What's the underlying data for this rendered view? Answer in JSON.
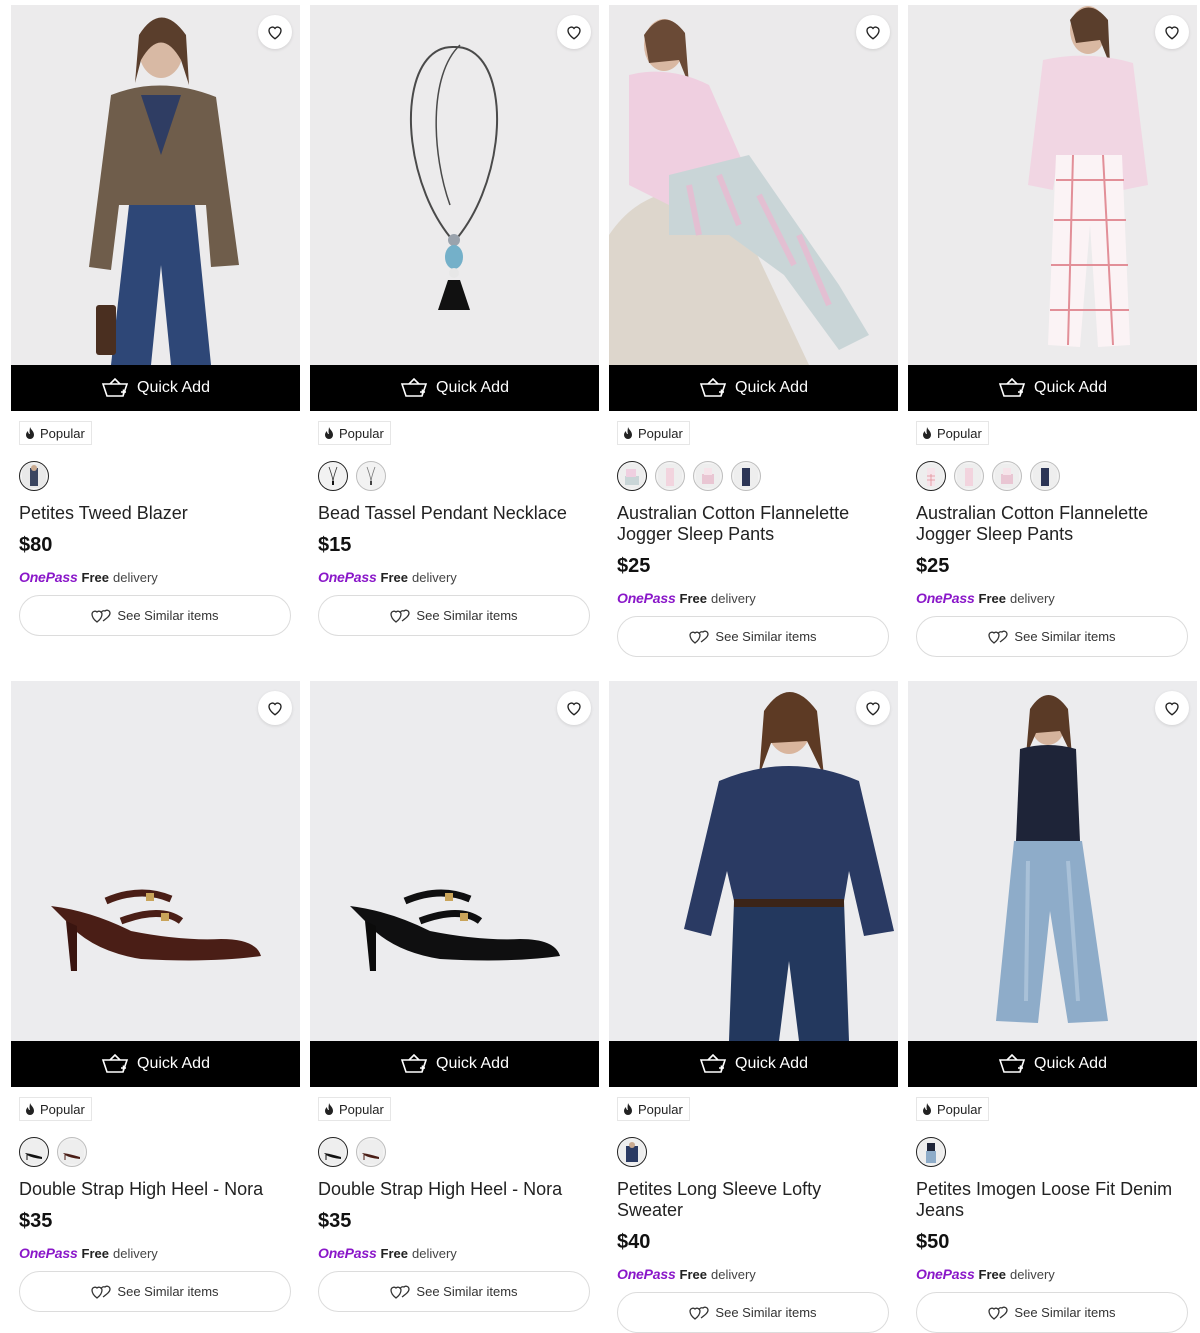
{
  "labels": {
    "quick_add": "Quick Add",
    "popular": "Popular",
    "onepass": "OnePass",
    "free": "Free",
    "delivery": "delivery",
    "see_similar": "See Similar items"
  },
  "colors": {
    "onepass": "#8a17c9",
    "quick_add_bg": "#000000",
    "image_bg": "#ececee"
  },
  "products": [
    {
      "name": "Petites Tweed Blazer",
      "price": "$80",
      "swatches": [
        "navy-model"
      ],
      "image": "model-blazer"
    },
    {
      "name": "Bead Tassel Pendant Necklace",
      "price": "$15",
      "swatches": [
        "black-necklace",
        "grey-necklace"
      ],
      "image": "necklace"
    },
    {
      "name": "Australian Cotton Flannelette Jogger Sleep Pants",
      "price": "$25",
      "swatches": [
        "pink-check",
        "pink-light",
        "pink-pattern",
        "navy"
      ],
      "image": "model-sleep-seated"
    },
    {
      "name": "Australian Cotton Flannelette Jogger Sleep Pants",
      "price": "$25",
      "swatches": [
        "pink-check",
        "pink-light",
        "pink-pattern",
        "navy"
      ],
      "image": "model-sleep-standing"
    },
    {
      "name": "Double Strap High Heel - Nora",
      "price": "$35",
      "swatches": [
        "black-patent",
        "brown-patent"
      ],
      "image": "heel-brown"
    },
    {
      "name": "Double Strap High Heel - Nora",
      "price": "$35",
      "swatches": [
        "black-patent",
        "brown-patent"
      ],
      "image": "heel-black"
    },
    {
      "name": "Petites Long Sleeve Lofty Sweater",
      "price": "$40",
      "swatches": [
        "navy-model"
      ],
      "image": "model-sweater"
    },
    {
      "name": "Petites Imogen Loose Fit Denim Jeans",
      "price": "$50",
      "swatches": [
        "denim-model"
      ],
      "image": "model-jeans"
    }
  ]
}
